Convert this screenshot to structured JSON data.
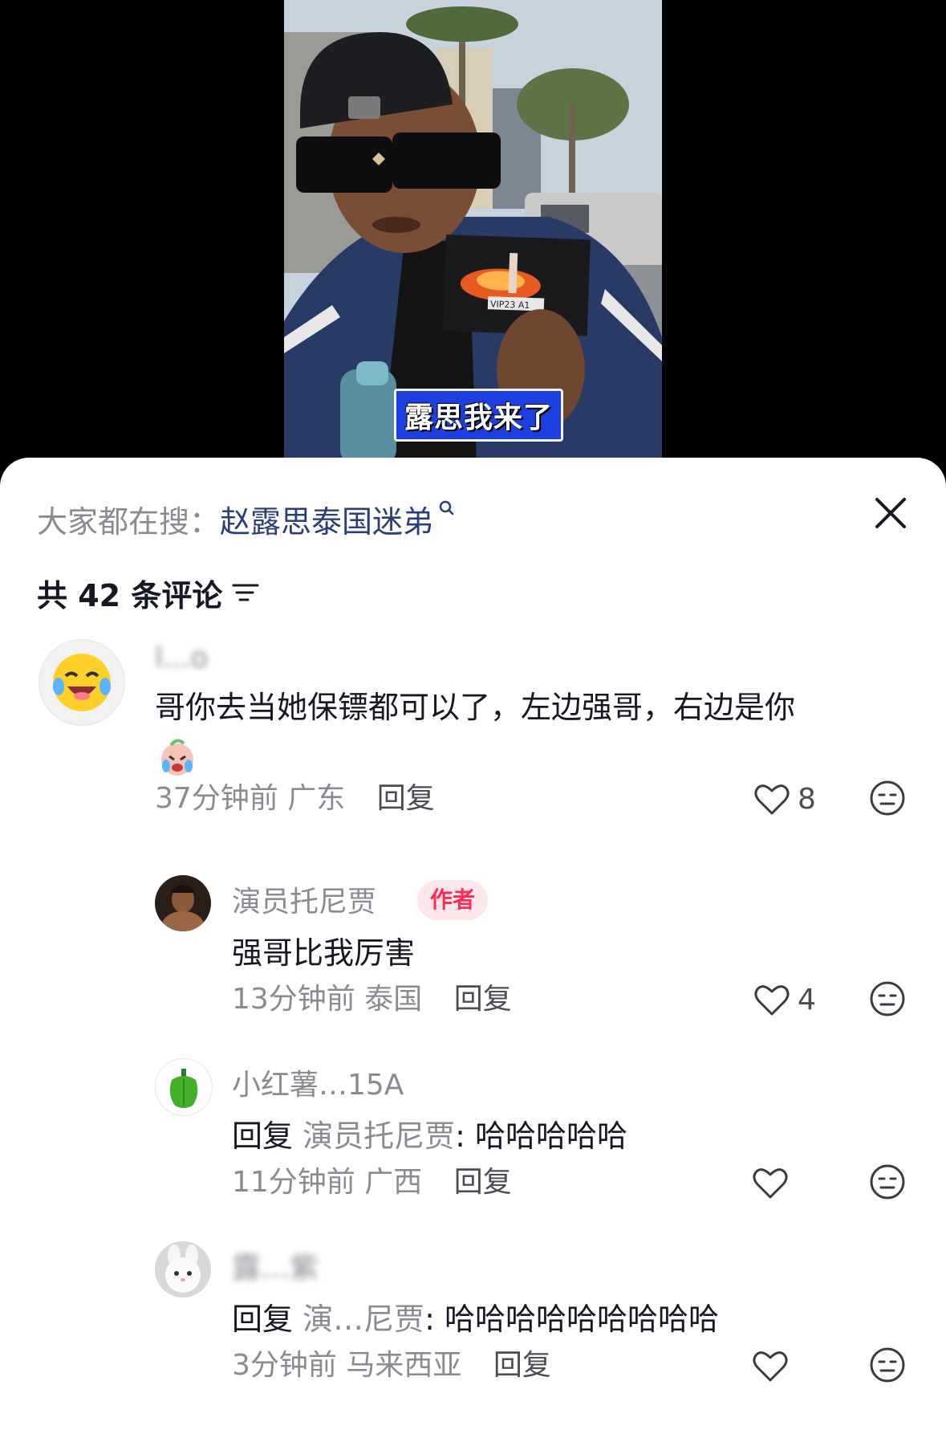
{
  "video": {
    "caption_sticker": "露思我来了",
    "ticket_text": "VIP23 A1"
  },
  "comments_panel": {
    "search_prefix": "大家都在搜：",
    "search_keyword": "赵露思泰国迷弟",
    "comment_count_label": "共 42 条评论",
    "comments": [
      {
        "username": "l...o",
        "text": "哥你去当她保镖都可以了，左边强哥，右边是你",
        "emoji": "crying-face-emoji",
        "time": "37分钟前",
        "location": "广东",
        "reply_label": "回复",
        "likes": "8"
      }
    ],
    "replies": [
      {
        "username": "演员托尼贾",
        "badge": "作者",
        "text": "强哥比我厉害",
        "time": "13分钟前",
        "location": "泰国",
        "reply_label": "回复",
        "likes": "4"
      },
      {
        "username": "小红薯…15A",
        "prefix": "回复",
        "mention": "演员托尼贾",
        "text": ": 哈哈哈哈哈",
        "time": "11分钟前",
        "location": "广西",
        "reply_label": "回复",
        "likes": ""
      },
      {
        "username": "露…紫",
        "prefix": "回复",
        "mention": "演…尼贾",
        "text": ": 哈哈哈哈哈哈哈哈哈",
        "time": "3分钟前",
        "location": "马来西亚",
        "reply_label": "回复",
        "likes": ""
      }
    ]
  },
  "colors": {
    "accent_red": "#fe2c55",
    "keyword_blue": "#2b3d7a",
    "muted_text": "#8a8b91"
  }
}
